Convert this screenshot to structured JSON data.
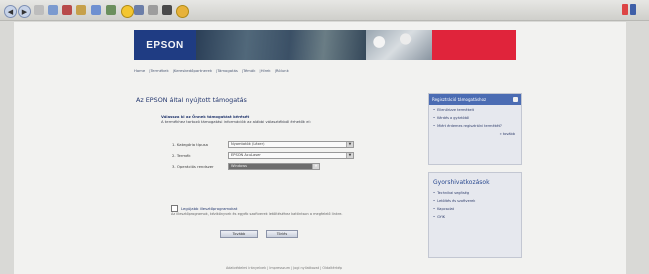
{
  "toolbar": {
    "icons": [
      "back-icon",
      "forward-icon",
      "stop-icon",
      "refresh-icon",
      "home-icon",
      "search-icon",
      "favorites-icon",
      "history-icon",
      "mail-icon",
      "print-icon",
      "edit-icon",
      "discuss-icon",
      "messenger-icon"
    ]
  },
  "banner": {
    "logo_text": "EPSON"
  },
  "nav": {
    "items": [
      "Home",
      "Termékek",
      "Kereskedőpartnerek",
      "Támogatás",
      "Témák",
      "Hírek",
      "Rólunk"
    ]
  },
  "main": {
    "heading": "Az EPSON által nyújtott támogatás",
    "intro_bold": "Válassza ki az Önnek támogatást kérését",
    "intro_text": "A termékhez tartozó támogatási információk az alábbi választékból érhetők el:",
    "fields": [
      {
        "label": "1. Kategória típusa",
        "value": "Nyomtatók (Lézer)"
      },
      {
        "label": "2. Termék",
        "value": "EPSON AcuLaser"
      },
      {
        "label": "3. Operációs rendszer",
        "value": "Windows"
      }
    ],
    "checkbox_label": "Legújabb illesztőprogramokat",
    "note": "Az illesztőprogramok, kézikönyvek és egyéb szoftverek letöltéséhez kattintson a megfelelő linkre.",
    "buttons": {
      "primary": "Tovább",
      "secondary": "Törlés"
    }
  },
  "sidebar": {
    "box1": {
      "title": "Regisztráció támogatáshoz",
      "items": [
        "Ellenőrizze termékeit",
        "Kérdés a gyártótól",
        "Miért érdemes regisztrálni termékét?"
      ],
      "more": "» tovább"
    },
    "box2": {
      "title": "Gyorshivatkozások",
      "items": [
        "Technikai segítség",
        "Letöltés és szoftverek",
        "Kapcsolat",
        "GYIK"
      ]
    }
  },
  "footer": {
    "text": "Adatvédelmi irányelvek | Impresszum | Jogi nyilatkozat | Oldaltérkép"
  }
}
